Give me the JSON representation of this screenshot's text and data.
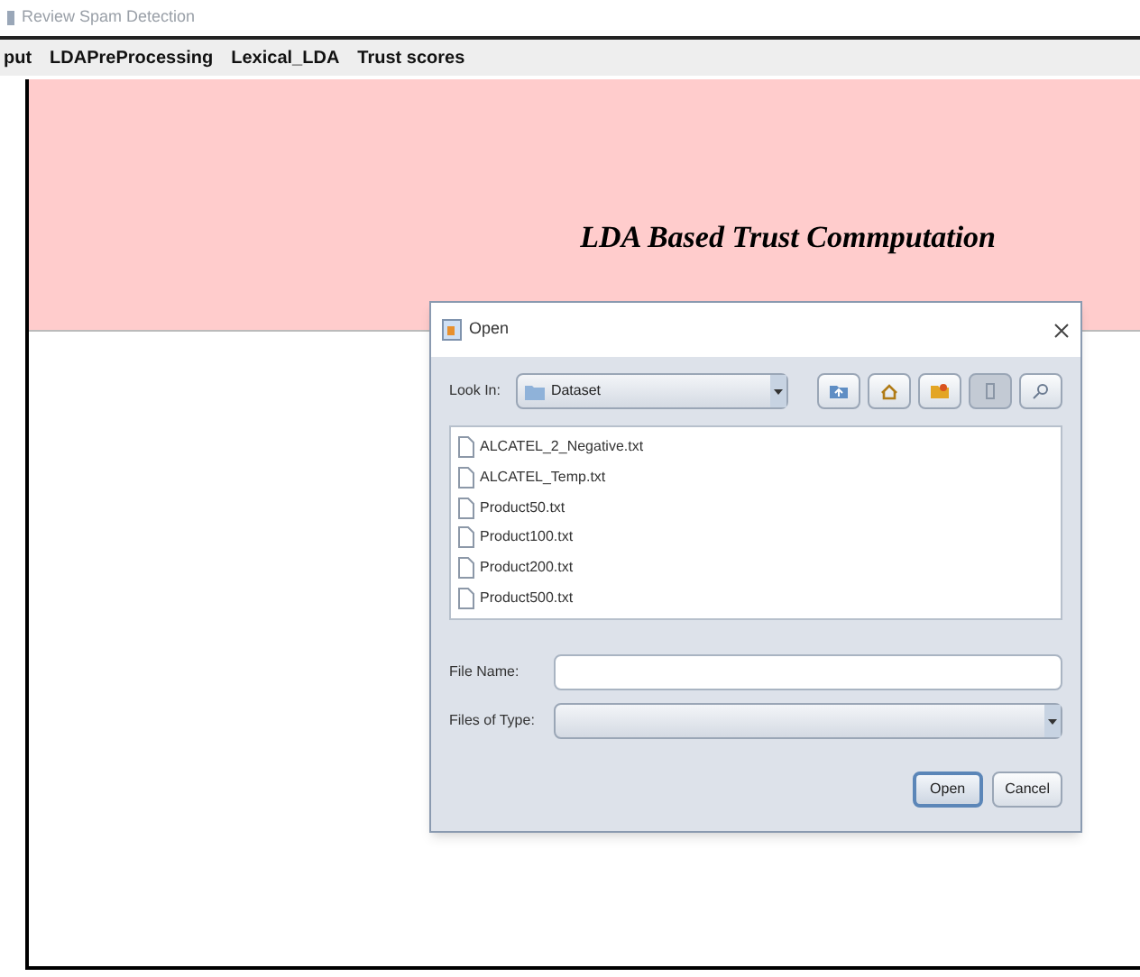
{
  "window": {
    "title": "Review Spam Detection"
  },
  "menu": {
    "items": [
      {
        "label": "put"
      },
      {
        "label": "LDAPreProcessing"
      },
      {
        "label": "Lexical_LDA"
      },
      {
        "label": "Trust scores"
      }
    ]
  },
  "banner": {
    "title": "LDA Based Trust Commputation"
  },
  "dialog": {
    "title": "Open",
    "look_in": {
      "label": "Look In:",
      "value": "Dataset"
    },
    "toolbar": [
      {
        "kind": "up",
        "selected": false
      },
      {
        "kind": "home",
        "selected": false
      },
      {
        "kind": "new_folder",
        "selected": false
      },
      {
        "kind": "list",
        "selected": true
      },
      {
        "kind": "details",
        "selected": false
      }
    ],
    "files": [
      {
        "name": "ALCATEL_2_Negative.txt"
      },
      {
        "name": "ALCATEL_Temp.txt"
      },
      {
        "name": "Product50.txt"
      },
      {
        "name": "Product100.txt"
      },
      {
        "name": "Product200.txt"
      },
      {
        "name": "Product500.txt"
      }
    ],
    "file_name": {
      "label": "File Name:"
    },
    "files_of_type": {
      "label": "Files of Type:"
    },
    "buttons": [
      {
        "label": "Open",
        "default": true
      },
      {
        "label": "Cancel",
        "default": false
      }
    ]
  }
}
